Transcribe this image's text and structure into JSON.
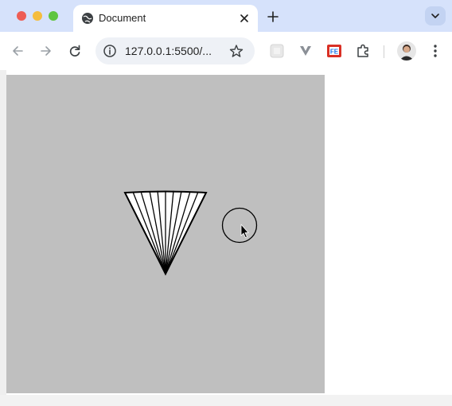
{
  "browser": {
    "tab": {
      "title": "Document",
      "icon": "globe-icon"
    },
    "address_bar": {
      "url": "127.0.0.1:5500/..."
    },
    "colors": {
      "tabstrip": "#d6e2fb",
      "toolbar": "#ffffff",
      "canvas": "#bfbfbf"
    }
  },
  "extensions": [
    "extension-1-icon",
    "vivaldi-like-icon",
    "fe-extension-icon",
    "puzzle-extensions-icon"
  ],
  "canvas": {
    "shapes": [
      "fan-shape",
      "circle-shape"
    ]
  }
}
